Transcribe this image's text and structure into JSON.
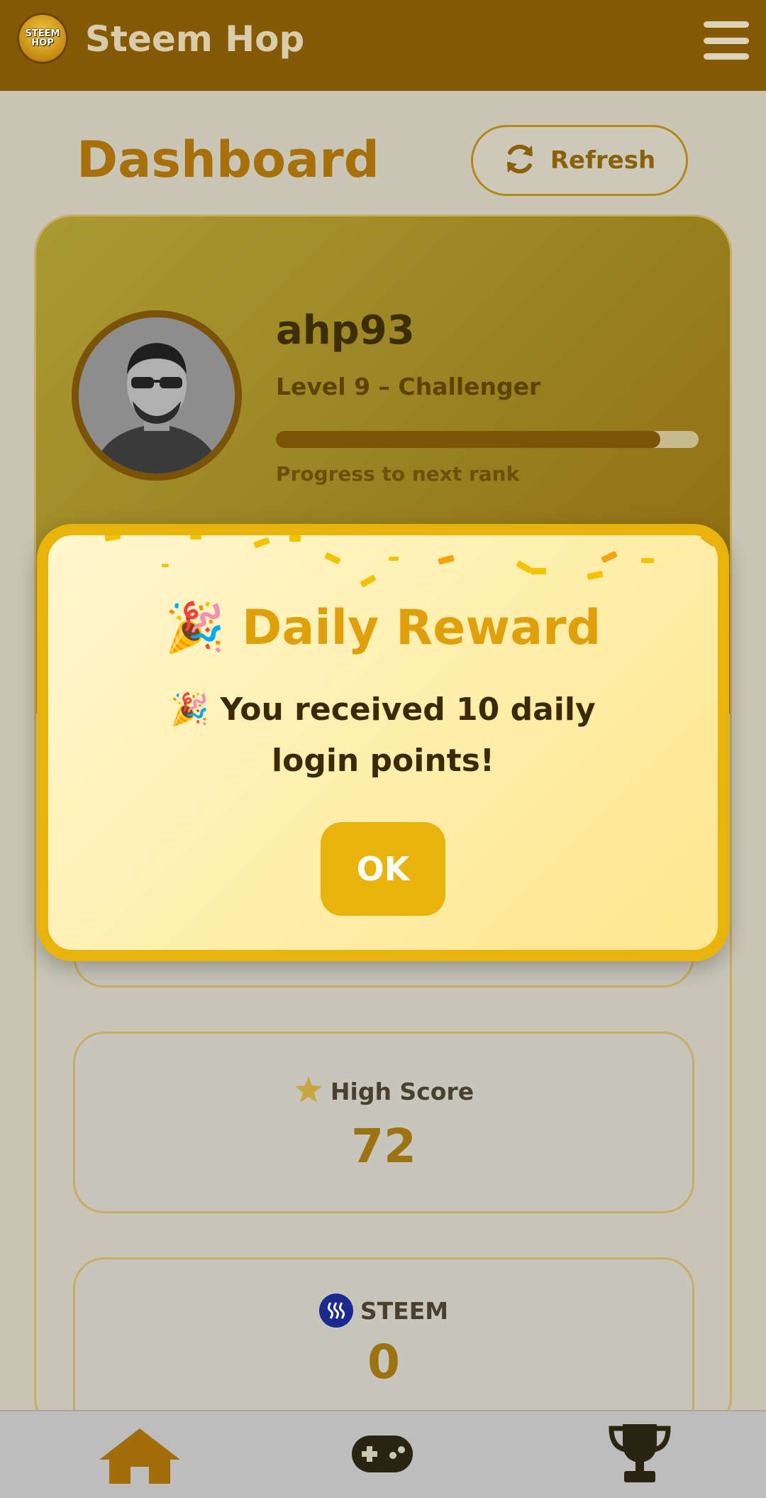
{
  "header": {
    "logo_text_line1": "STEEM",
    "logo_text_line2": "HOP",
    "app_title": "Steem Hop",
    "menu_icon": "hamburger-menu-icon"
  },
  "main": {
    "page_title": "Dashboard",
    "refresh_label": "Refresh",
    "refresh_icon": "refresh-icon"
  },
  "profile": {
    "username": "ahp93",
    "level": "Level 9 – Challenger",
    "progress_label": "Progress to next rank",
    "progress_fraction": 0.91
  },
  "stats": [
    {
      "label": "High Score",
      "value": "72",
      "icon": "star-icon"
    },
    {
      "label": "STEEM",
      "value": "0",
      "icon": "steem-logo-icon"
    }
  ],
  "modal": {
    "title_emoji": "🎉",
    "title": "Daily Reward",
    "message": "🎉 You received 10 daily login points!",
    "ok_label": "OK"
  },
  "bottom_nav": {
    "items": [
      "home-icon",
      "gamepad-icon",
      "trophy-icon"
    ]
  },
  "colors": {
    "header": "#855a06",
    "accent": "#e8b30c",
    "progress_fill": "#7c5307"
  }
}
